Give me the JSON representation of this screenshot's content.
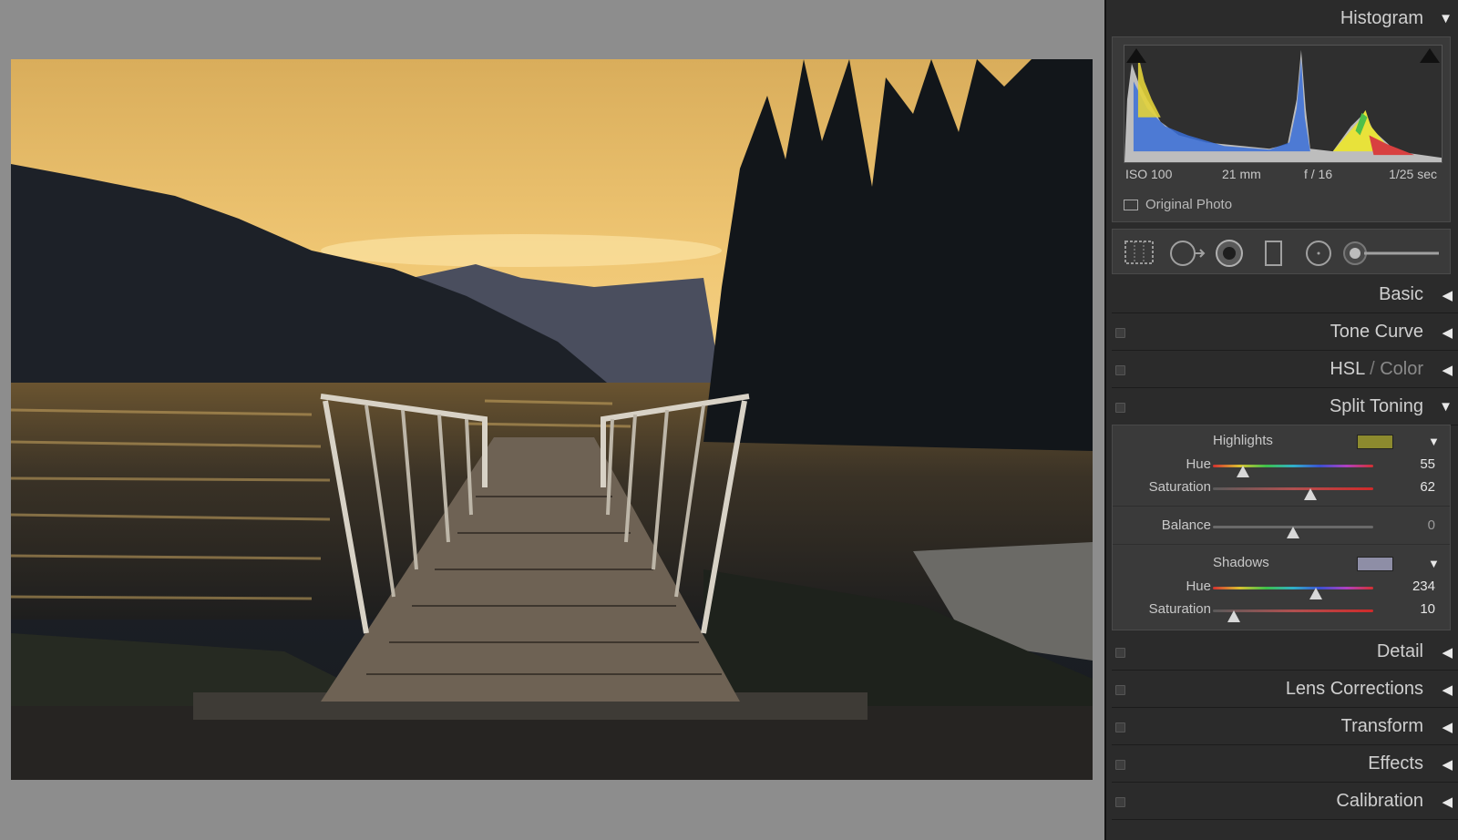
{
  "histogram": {
    "title": "Histogram",
    "iso": "ISO 100",
    "focal": "21 mm",
    "aperture": "f / 16",
    "shutter": "1/25 sec",
    "original_photo_label": "Original Photo"
  },
  "panels": {
    "basic": "Basic",
    "tone_curve": "Tone Curve",
    "hsl": "HSL",
    "hsl_sep": " / ",
    "color": "Color",
    "split_toning": "Split Toning",
    "detail": "Detail",
    "lens_corrections": "Lens Corrections",
    "transform": "Transform",
    "effects": "Effects",
    "calibration": "Calibration"
  },
  "split_toning": {
    "highlights": {
      "label": "Highlights",
      "color": "#8c8a2e",
      "hue_label": "Hue",
      "hue": "55",
      "sat_label": "Saturation",
      "sat": "62"
    },
    "balance": {
      "label": "Balance",
      "value": "0"
    },
    "shadows": {
      "label": "Shadows",
      "color": "#8e8ea6",
      "hue_label": "Hue",
      "hue": "234",
      "sat_label": "Saturation",
      "sat": "10"
    }
  },
  "slider_levels": {
    "highlights_hue_pct": 19,
    "highlights_sat_pct": 61,
    "balance_pct": 50,
    "shadows_hue_pct": 64,
    "shadows_sat_pct": 13
  },
  "colors": {
    "panel_bg": "#2b2b2b",
    "section_bg": "#3a3a3a",
    "canvas_bg": "#8d8d8d"
  }
}
